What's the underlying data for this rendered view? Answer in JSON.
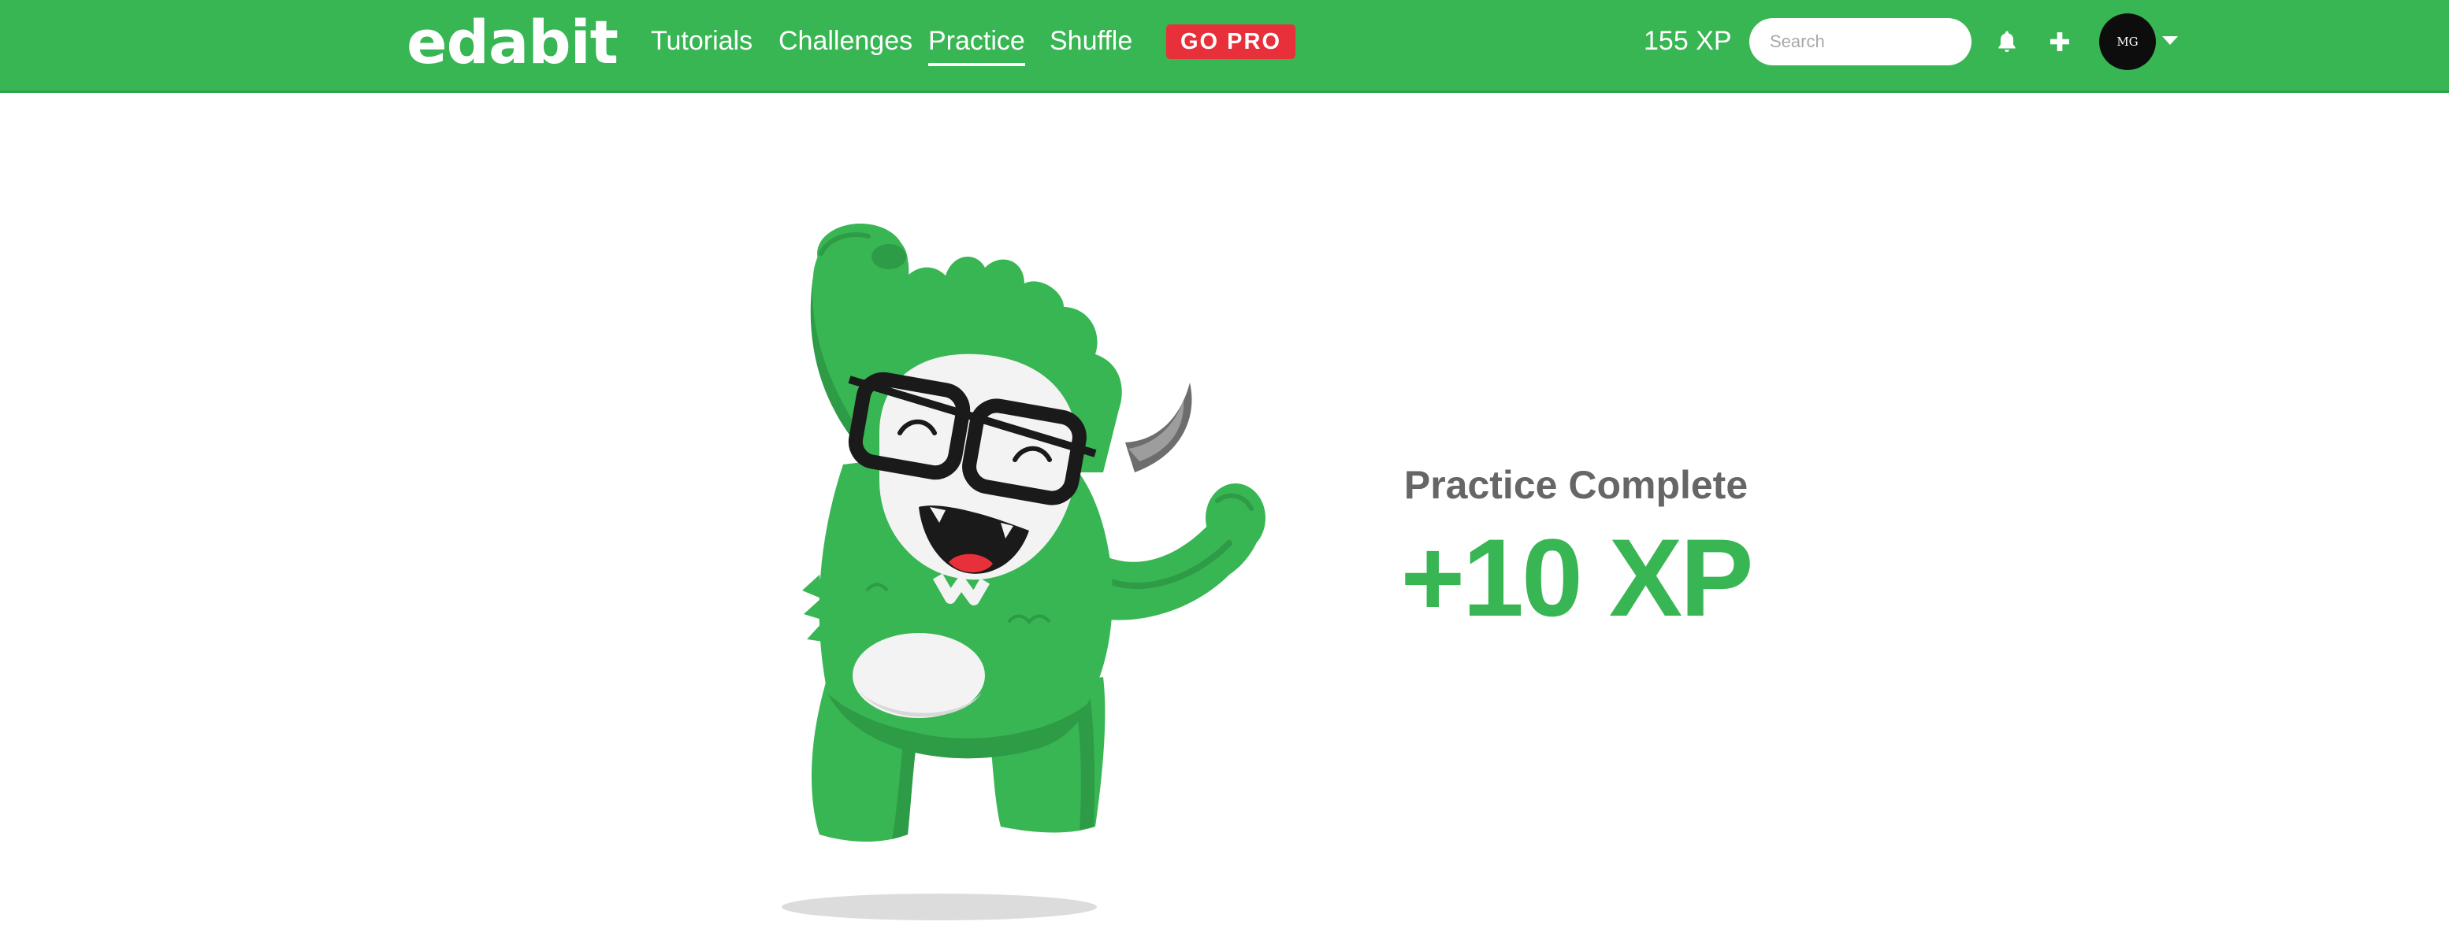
{
  "brand": {
    "logo_text": "edabit",
    "primary_color": "#38b653",
    "pro_color": "#e8303a"
  },
  "nav": {
    "links": [
      {
        "label": "Tutorials",
        "active": false
      },
      {
        "label": "Challenges",
        "active": false
      },
      {
        "label": "Practice",
        "active": true
      },
      {
        "label": "Shuffle",
        "active": false
      }
    ],
    "go_pro_label": "GO PRO"
  },
  "header": {
    "xp_label": "155 XP",
    "search_placeholder": "Search",
    "search_value": "",
    "notification_icon": "bell-icon",
    "add_icon": "plus-icon",
    "avatar_initials": "MG",
    "account_menu_icon": "caret-down-icon"
  },
  "result": {
    "title": "Practice Complete",
    "xp_gained": "+10 XP",
    "illustration": "celebrating-green-monster-with-glasses"
  }
}
